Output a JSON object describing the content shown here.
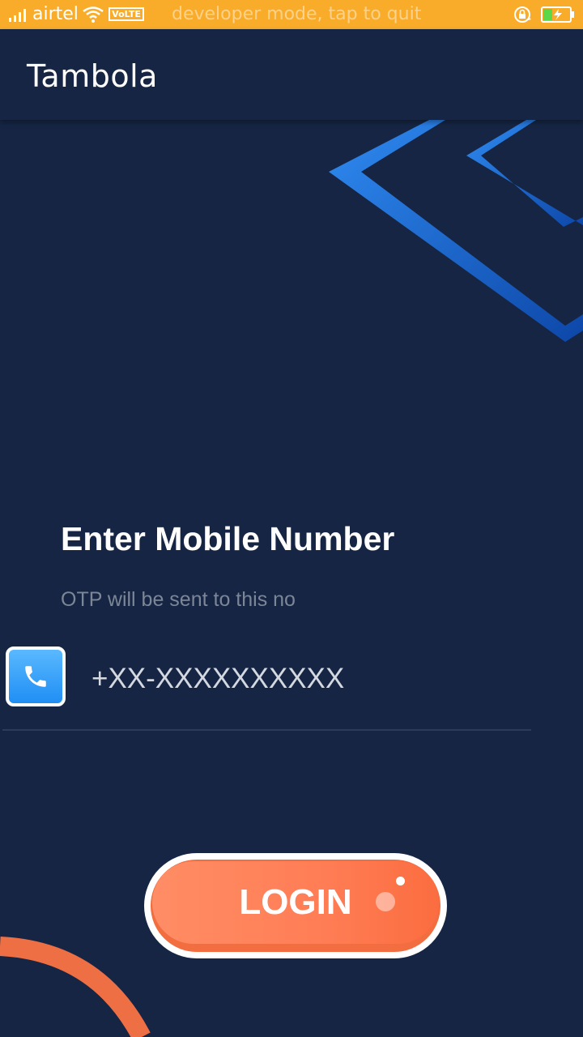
{
  "status_bar": {
    "carrier": "airtel",
    "network_badge": "VoLTE",
    "notice": "developer mode, tap to quit",
    "icons": [
      "signal-icon",
      "wifi-icon",
      "rotation-lock-icon",
      "battery-charging-icon"
    ],
    "background_color": "#f9ac2a"
  },
  "app_bar": {
    "title": "Tambola"
  },
  "login": {
    "heading": "Enter Mobile Number",
    "subtitle": "OTP will be sent to this no",
    "phone_placeholder": "+XX-XXXXXXXXXX",
    "phone_icon": "phone-icon",
    "button_label": "LOGIN"
  },
  "colors": {
    "background": "#152543",
    "accent_blue": "#2f8af0",
    "accent_orange": "#f26d3f",
    "muted_text": "#7d8697"
  }
}
